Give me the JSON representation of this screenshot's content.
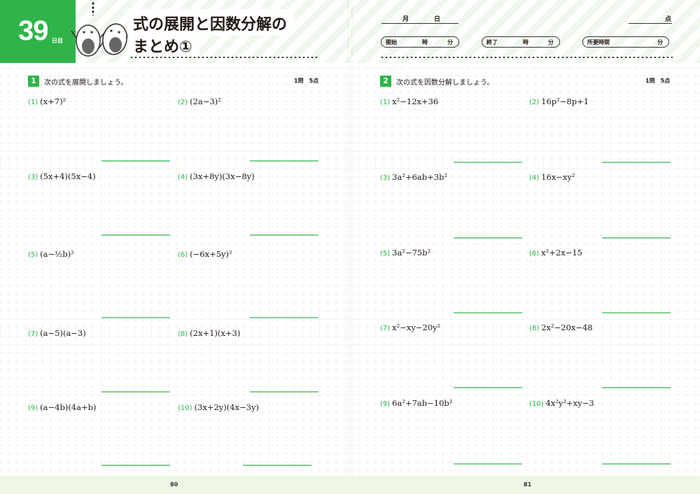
{
  "header": {
    "day_number": "39",
    "day_unit": "日目",
    "title_line1": "式の展開と因数分解の",
    "title_line2": "まとめ①"
  },
  "record": {
    "month_label": "月",
    "day_label": "日",
    "score_label": "点",
    "start_label": "開始",
    "end_label": "終了",
    "elapsed_label": "所要時間",
    "hour_label": "時",
    "minute_label": "分"
  },
  "section1": {
    "number": "1",
    "instruction": "次の式を展開しましょう。",
    "points": "1問　5点",
    "problems": [
      {
        "num": "(1)",
        "expr": "(x+7)²"
      },
      {
        "num": "(2)",
        "expr": "(2a−3)²"
      },
      {
        "num": "(3)",
        "expr": "(5x+4)(5x−4)"
      },
      {
        "num": "(4)",
        "expr": "(3x+8y)(3x−8y)"
      },
      {
        "num": "(5)",
        "expr": "(a−½b)²"
      },
      {
        "num": "(6)",
        "expr": "(−6x+5y)²"
      },
      {
        "num": "(7)",
        "expr": "(a−5)(a−3)"
      },
      {
        "num": "(8)",
        "expr": "(2x+1)(x+3)"
      },
      {
        "num": "(9)",
        "expr": "(a−4b)(4a+b)"
      },
      {
        "num": "(10)",
        "expr": "(3x+2y)(4x−3y)"
      }
    ]
  },
  "section2": {
    "number": "2",
    "instruction": "次の式を因数分解しましょう。",
    "points": "1問　5点",
    "problems": [
      {
        "num": "(1)",
        "expr": "x²−12x+36"
      },
      {
        "num": "(2)",
        "expr": "16p²−8p+1"
      },
      {
        "num": "(3)",
        "expr": "3a²+6ab+3b²"
      },
      {
        "num": "(4)",
        "expr": "16x−xy²"
      },
      {
        "num": "(5)",
        "expr": "3a²−75b²"
      },
      {
        "num": "(6)",
        "expr": "x²+2x−15"
      },
      {
        "num": "(7)",
        "expr": "x²−xy−20y²"
      },
      {
        "num": "(8)",
        "expr": "2x²−20x−48"
      },
      {
        "num": "(9)",
        "expr": "6a²+7ab−10b²"
      },
      {
        "num": "(10)",
        "expr": "4x²y²+xy−3"
      }
    ]
  },
  "footer": {
    "left_page": "80",
    "right_page": "81"
  },
  "colors": {
    "accent": "#2fb44a",
    "answer_line": "#7fd08f"
  }
}
